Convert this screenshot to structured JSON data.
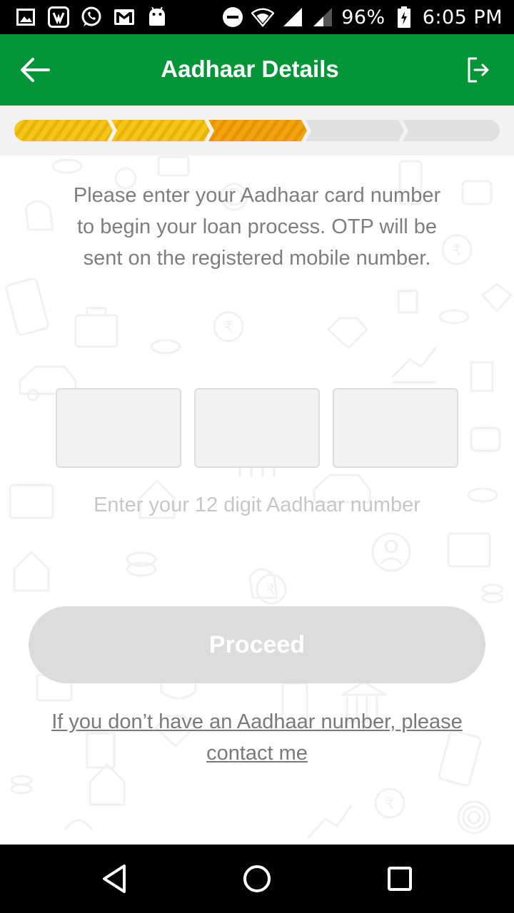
{
  "status_bar": {
    "battery": "96%",
    "time": "6:05 PM",
    "icons": [
      "gallery-icon",
      "jio-icon",
      "whatsapp-icon",
      "gmail-icon",
      "android-icon",
      "do-not-disturb-icon",
      "wifi-icon",
      "signal-icon",
      "signal-weak-icon",
      "battery-charging-icon"
    ]
  },
  "app_bar": {
    "title": "Aadhaar Details",
    "back_icon": "arrow-left-icon",
    "exit_icon": "logout-icon",
    "color": "#029537"
  },
  "progress": {
    "total_steps": 5,
    "completed_steps": 2,
    "current_step": 3,
    "colors": {
      "completed": "#f5c518",
      "current": "#f2a40f",
      "pending": "#e0e0e0"
    }
  },
  "main": {
    "instruction": "Please enter your Aadhaar card number to begin your loan process. OTP will be sent on the registered mobile number.",
    "aadhaar_fields": [
      "",
      "",
      ""
    ],
    "hint": "Enter your 12 digit Aadhaar number",
    "proceed_label": "Proceed",
    "contact_link": "If you don’t have an Aadhaar number, please contact me"
  },
  "nav_bar": {
    "icons": [
      "back-triangle-icon",
      "home-circle-icon",
      "recents-square-icon"
    ]
  }
}
